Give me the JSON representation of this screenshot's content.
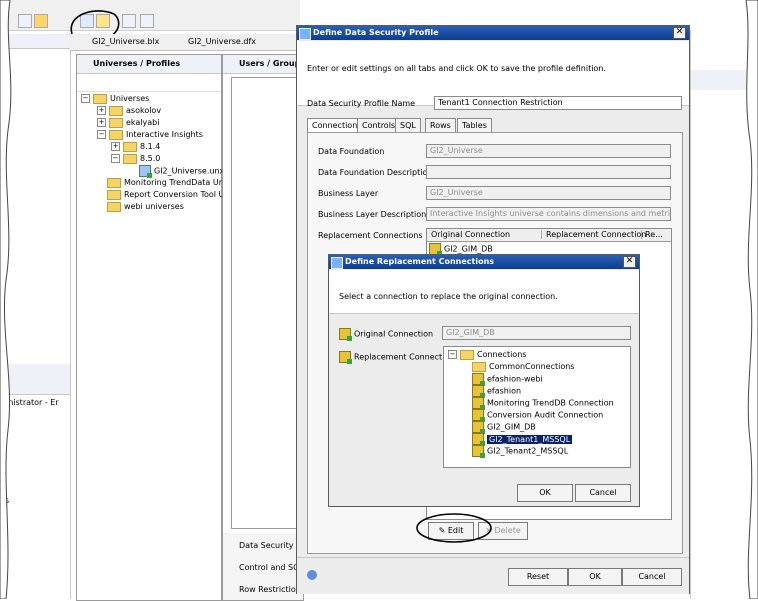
{
  "editor_tabs": [
    "GI2_Universe.blx",
    "GI2_Universe.dfx"
  ],
  "universes_panel": {
    "title": "Universes / Profiles",
    "tree": [
      {
        "label": "Universes",
        "indent": 0,
        "toggle": "−",
        "type": "folder"
      },
      {
        "label": "asokolov",
        "indent": 1,
        "toggle": "+",
        "type": "folder"
      },
      {
        "label": "ekalyabi",
        "indent": 1,
        "toggle": "+",
        "type": "folder"
      },
      {
        "label": "Interactive Insights",
        "indent": 1,
        "toggle": "−",
        "type": "folder"
      },
      {
        "label": "8.1.4",
        "indent": 2,
        "toggle": "+",
        "type": "folder"
      },
      {
        "label": "8.5.0",
        "indent": 2,
        "toggle": "−",
        "type": "folder"
      },
      {
        "label": "GI2_Universe.unx",
        "indent": 3,
        "toggle": "",
        "type": "file"
      },
      {
        "label": "Monitoring TrendData Unive",
        "indent": 1,
        "toggle": "",
        "type": "folder"
      },
      {
        "label": "Report Conversion Tool Univ",
        "indent": 1,
        "toggle": "",
        "type": "folder"
      },
      {
        "label": "webi universes",
        "indent": 1,
        "toggle": "",
        "type": "folder"
      }
    ]
  },
  "users_panel": {
    "title": "Users / Group",
    "bottom_title": "Data Security Pr",
    "bottom_rows": [
      "Control and SQL",
      "Row Restriction"
    ]
  },
  "left_partial_text": [
    "inistrator - Er",
    "es"
  ],
  "dsp_dialog": {
    "title": "Define Data Security Profile",
    "instructions": "Enter or edit settings on all tabs and click OK to save the profile definition.",
    "profile_name_label": "Data Security Profile Name",
    "profile_name_value": "Tenant1 Connection Restriction",
    "tabs": [
      "Connections",
      "Controls",
      "SQL",
      "Rows",
      "Tables"
    ],
    "fields": [
      {
        "label": "Data Foundation",
        "value": "GI2_Universe"
      },
      {
        "label": "Data Foundation Description",
        "value": ""
      },
      {
        "label": "Business Layer",
        "value": "GI2_Universe"
      },
      {
        "label": "Business Layer Description",
        "value": "Interactive Insights universe contains dimensions and metrics that car"
      }
    ],
    "replacement_label": "Replacement Connections",
    "table_headers": [
      "Original Connection",
      "Replacement Connection",
      "Re..."
    ],
    "table_rows": [
      [
        "GI2_GIM_DB",
        "",
        ""
      ]
    ],
    "edit_button": "Edit",
    "delete_button": "Delete",
    "reset_button": "Reset",
    "ok_button": "OK",
    "cancel_button": "Cancel"
  },
  "replace_dialog": {
    "title": "Define Replacement Connections",
    "instructions": "Select a connection to replace the original connection.",
    "original_label": "Original Connection",
    "original_value": "GI2_GIM_DB",
    "replacement_label": "Replacement Connection",
    "tree": [
      {
        "label": "Connections",
        "indent": 0,
        "type": "root"
      },
      {
        "label": "CommonConnections",
        "indent": 1,
        "type": "folder"
      },
      {
        "label": "efashion-webi",
        "indent": 1,
        "type": "conn"
      },
      {
        "label": "efashion",
        "indent": 1,
        "type": "conn"
      },
      {
        "label": "Monitoring TrendDB Connection",
        "indent": 1,
        "type": "conn"
      },
      {
        "label": "Conversion Audit Connection",
        "indent": 1,
        "type": "conn"
      },
      {
        "label": "GI2_GIM_DB",
        "indent": 1,
        "type": "conn"
      },
      {
        "label": "GI2_Tenant1_MSSQL",
        "indent": 1,
        "type": "conn",
        "selected": true
      },
      {
        "label": "GI2_Tenant2_MSSQL",
        "indent": 1,
        "type": "conn"
      }
    ],
    "ok_button": "OK",
    "cancel_button": "Cancel"
  },
  "colors": {
    "title_bar": "#0b3d91",
    "selection": "#0a246a",
    "folder": "#f3d36b",
    "annotation": "#000000"
  }
}
